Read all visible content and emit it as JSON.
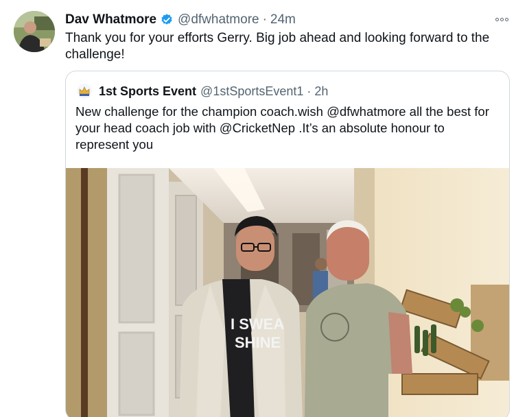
{
  "tweet": {
    "display_name": "Dav Whatmore",
    "handle": "@dfwhatmore",
    "separator": "·",
    "time": "24m",
    "text": "Thank you for your efforts Gerry. Big job ahead and looking forward to the challenge!",
    "icons": {
      "verified": "verified-badge-icon",
      "more": "more-options-icon"
    },
    "colors": {
      "verified": "#1d9bf0",
      "secondary_text": "#536471",
      "border": "#cfd9de"
    }
  },
  "quoted_tweet": {
    "display_name": "1st Sports Event",
    "handle": "@1stSportsEvent1",
    "separator": "·",
    "time": "2h",
    "text": "New challenge for the champion coach.wish @dfwhatmore all the best for your head coach job with @CricketNep .It’s an absolute honour to represent you",
    "photo": {
      "shirt_text_line1": "I SWEA",
      "shirt_text_line2": "SHINE"
    }
  }
}
